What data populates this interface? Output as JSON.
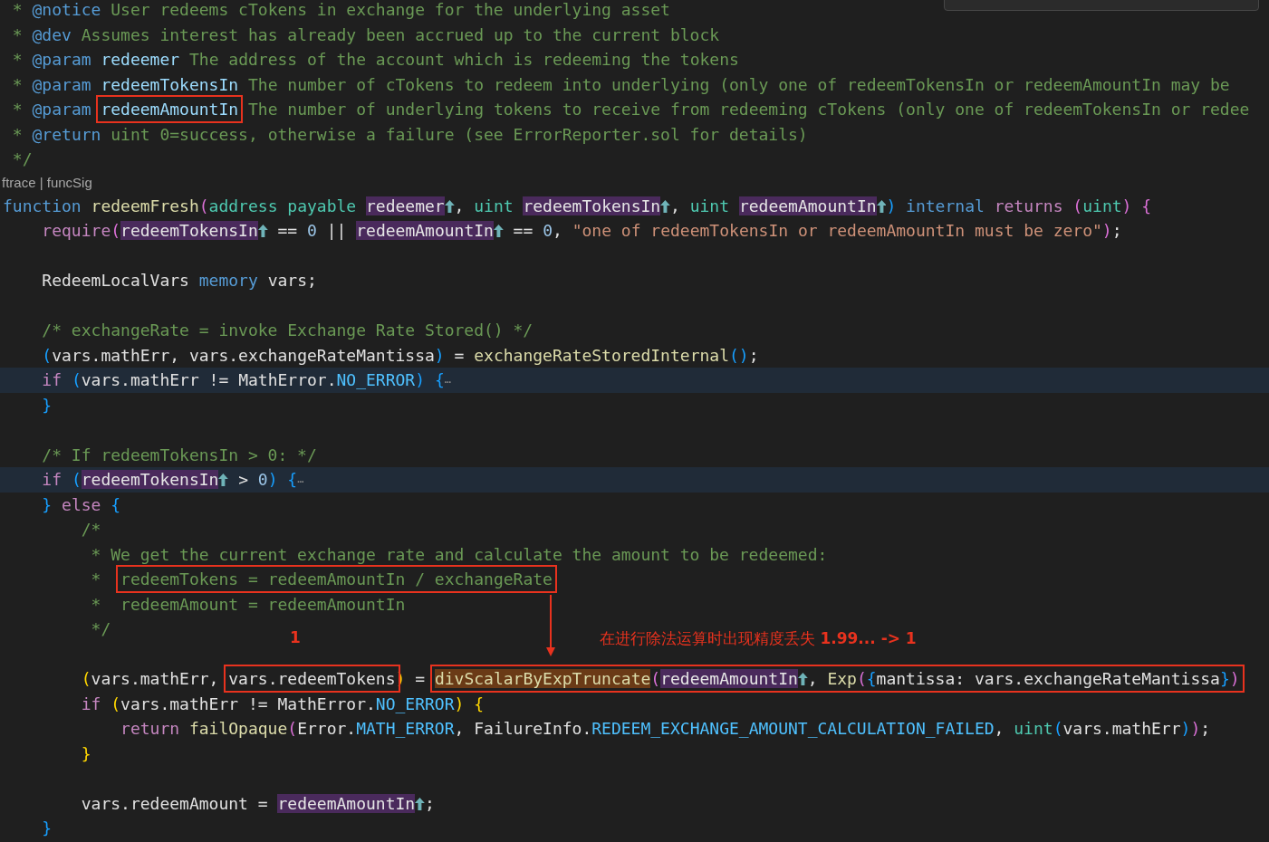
{
  "editor": {
    "lines": [
      {
        "highlighted": false,
        "tokens": [
          {
            "kind": "comment",
            "text": " * "
          },
          {
            "kind": "tag",
            "text": "@notice"
          },
          {
            "kind": "comment",
            "text": " User redeems cTokens in exchange for the underlying asset"
          }
        ]
      },
      {
        "highlighted": false,
        "tokens": [
          {
            "kind": "comment",
            "text": " * "
          },
          {
            "kind": "tag",
            "text": "@dev"
          },
          {
            "kind": "comment",
            "text": " Assumes interest has already been accrued up to the current block"
          }
        ]
      },
      {
        "highlighted": false,
        "tokens": [
          {
            "kind": "comment",
            "text": " * "
          },
          {
            "kind": "tag",
            "text": "@param"
          },
          {
            "kind": "doc",
            "text": " redeemer"
          },
          {
            "kind": "comment",
            "text": " The address of the account which is redeeming the tokens"
          }
        ]
      },
      {
        "highlighted": false,
        "tokens": [
          {
            "kind": "comment",
            "text": " * "
          },
          {
            "kind": "tag",
            "text": "@param"
          },
          {
            "kind": "doc",
            "text": " redeemTokensIn"
          },
          {
            "kind": "comment",
            "text": " The number of cTokens to redeem into underlying (only one of redeemTokensIn or redeemAmountIn may be"
          }
        ]
      },
      {
        "highlighted": false,
        "tokens": [
          {
            "kind": "comment",
            "text": " * "
          },
          {
            "kind": "tag",
            "text": "@param "
          },
          {
            "kind": "box",
            "children": [
              {
                "kind": "doc",
                "text": "redeemAmountIn"
              }
            ]
          },
          {
            "kind": "comment",
            "text": " The number of underlying tokens to receive from redeeming cTokens (only one of redeemTokensIn or redee"
          }
        ]
      },
      {
        "highlighted": false,
        "tokens": [
          {
            "kind": "comment",
            "text": " * "
          },
          {
            "kind": "tag",
            "text": "@return"
          },
          {
            "kind": "comment",
            "text": " uint 0=success, otherwise a failure (see ErrorReporter.sol for details)"
          }
        ]
      },
      {
        "highlighted": false,
        "tokens": [
          {
            "kind": "comment",
            "text": " */"
          }
        ]
      },
      {
        "highlighted": false,
        "lens": true,
        "tokens": [
          {
            "kind": "lens",
            "text": "ftrace"
          },
          {
            "kind": "sep",
            "text": " | "
          },
          {
            "kind": "lens",
            "text": "funcSig"
          }
        ]
      },
      {
        "highlighted": false,
        "tokens": [
          {
            "kind": "kw",
            "text": "function "
          },
          {
            "kind": "fn",
            "text": "redeemFresh"
          },
          {
            "kind": "br2",
            "text": "("
          },
          {
            "kind": "type",
            "text": "address payable "
          },
          {
            "kind": "ref",
            "text": "redeemer"
          },
          {
            "kind": "id",
            "text": ", "
          },
          {
            "kind": "type",
            "text": "uint "
          },
          {
            "kind": "ref",
            "text": "redeemTokensIn"
          },
          {
            "kind": "id",
            "text": ", "
          },
          {
            "kind": "type",
            "text": "uint "
          },
          {
            "kind": "ref",
            "text": "redeemAmountIn"
          },
          {
            "kind": "br3",
            "text": ") "
          },
          {
            "kind": "kw",
            "text": "internal "
          },
          {
            "kind": "ctl",
            "text": "returns "
          },
          {
            "kind": "br2",
            "text": "("
          },
          {
            "kind": "type",
            "text": "uint"
          },
          {
            "kind": "br2",
            "text": ") {"
          }
        ]
      },
      {
        "highlighted": false,
        "tokens": [
          {
            "kind": "ctl",
            "text": "    require"
          },
          {
            "kind": "br2",
            "text": "("
          },
          {
            "kind": "ref",
            "text": "redeemTokensIn"
          },
          {
            "kind": "id",
            "text": " == "
          },
          {
            "kind": "num",
            "text": "0"
          },
          {
            "kind": "id",
            "text": " || "
          },
          {
            "kind": "ref",
            "text": "redeemAmountIn"
          },
          {
            "kind": "id",
            "text": " == "
          },
          {
            "kind": "num",
            "text": "0"
          },
          {
            "kind": "id",
            "text": ", "
          },
          {
            "kind": "str",
            "text": "\"one of redeemTokensIn or redeemAmountIn must be zero\""
          },
          {
            "kind": "br2",
            "text": ")"
          },
          {
            "kind": "id",
            "text": ";"
          }
        ]
      },
      {
        "highlighted": false
      },
      {
        "highlighted": false,
        "tokens": [
          {
            "kind": "id",
            "text": "    RedeemLocalVars "
          },
          {
            "kind": "kw",
            "text": "memory"
          },
          {
            "kind": "id",
            "text": " vars;"
          }
        ]
      },
      {
        "highlighted": false
      },
      {
        "highlighted": false,
        "tokens": [
          {
            "kind": "comment",
            "text": "    /* exchangeRate = invoke Exchange Rate Stored() */"
          }
        ]
      },
      {
        "highlighted": false,
        "tokens": [
          {
            "kind": "br3",
            "text": "    ("
          },
          {
            "kind": "id",
            "text": "vars.mathErr, vars.exchangeRateMantissa"
          },
          {
            "kind": "br3",
            "text": ")"
          },
          {
            "kind": "id",
            "text": " = "
          },
          {
            "kind": "fn",
            "text": "exchangeRateStoredInternal"
          },
          {
            "kind": "br3",
            "text": "()"
          },
          {
            "kind": "id",
            "text": ";"
          }
        ]
      },
      {
        "highlighted": true,
        "tokens": [
          {
            "kind": "ctl",
            "text": "    if "
          },
          {
            "kind": "br3",
            "text": "("
          },
          {
            "kind": "id",
            "text": "vars.mathErr != MathError."
          },
          {
            "kind": "const",
            "text": "NO_ERROR"
          },
          {
            "kind": "br3",
            "text": ") {"
          },
          {
            "kind": "fold",
            "text": "⋯"
          }
        ]
      },
      {
        "highlighted": false,
        "tokens": [
          {
            "kind": "br3",
            "text": "    }"
          }
        ]
      },
      {
        "highlighted": false
      },
      {
        "highlighted": false,
        "tokens": [
          {
            "kind": "comment",
            "text": "    /* If redeemTokensIn > 0: */"
          }
        ]
      },
      {
        "highlighted": true,
        "tokens": [
          {
            "kind": "ctl",
            "text": "    if "
          },
          {
            "kind": "br3",
            "text": "("
          },
          {
            "kind": "ref",
            "text": "redeemTokensIn"
          },
          {
            "kind": "id",
            "text": " > "
          },
          {
            "kind": "num",
            "text": "0"
          },
          {
            "kind": "br3",
            "text": ") {"
          },
          {
            "kind": "fold",
            "text": "⋯"
          }
        ]
      },
      {
        "highlighted": false,
        "tokens": [
          {
            "kind": "br3",
            "text": "    }"
          },
          {
            "kind": "ctl",
            "text": " else "
          },
          {
            "kind": "br3",
            "text": "{"
          }
        ]
      },
      {
        "highlighted": false,
        "tokens": [
          {
            "kind": "comment",
            "text": "        /*"
          }
        ]
      },
      {
        "highlighted": false,
        "tokens": [
          {
            "kind": "comment",
            "text": "         * We get the current exchange rate and calculate the amount to be redeemed:"
          }
        ]
      },
      {
        "highlighted": false,
        "tokens": [
          {
            "kind": "comment",
            "text": "         *  "
          },
          {
            "kind": "box",
            "children": [
              {
                "kind": "comment",
                "text": "redeemTokens = redeemAmountIn / exchangeRate"
              }
            ]
          }
        ]
      },
      {
        "highlighted": false,
        "tokens": [
          {
            "kind": "comment",
            "text": "         *  redeemAmount = redeemAmountIn"
          }
        ]
      },
      {
        "highlighted": false,
        "tokens": [
          {
            "kind": "comment",
            "text": "         */"
          }
        ]
      },
      {
        "highlighted": false
      },
      {
        "highlighted": false,
        "tokens": [
          {
            "kind": "br1",
            "text": "        ("
          },
          {
            "kind": "id",
            "text": "vars.mathErr, "
          },
          {
            "kind": "box",
            "children": [
              {
                "kind": "id",
                "text": "vars.redeemTokens"
              }
            ]
          },
          {
            "kind": "br1",
            "text": ")"
          },
          {
            "kind": "id",
            "text": " = "
          },
          {
            "kind": "box",
            "children": [
              {
                "kind": "fnhl",
                "text": "divScalarByExpTruncate"
              },
              {
                "kind": "br2",
                "text": "("
              },
              {
                "kind": "ref",
                "text": "redeemAmountIn"
              },
              {
                "kind": "id",
                "text": ", "
              },
              {
                "kind": "fn",
                "text": "Exp"
              },
              {
                "kind": "br2",
                "text": "("
              },
              {
                "kind": "br3",
                "text": "{"
              },
              {
                "kind": "id",
                "text": "mantissa: vars.exchangeRateMantissa"
              },
              {
                "kind": "br3",
                "text": "}"
              },
              {
                "kind": "br2",
                "text": ")"
              }
            ]
          }
        ]
      },
      {
        "highlighted": false,
        "tokens": [
          {
            "kind": "ctl",
            "text": "        if "
          },
          {
            "kind": "br1",
            "text": "("
          },
          {
            "kind": "id",
            "text": "vars.mathErr != MathError."
          },
          {
            "kind": "const",
            "text": "NO_ERROR"
          },
          {
            "kind": "br1",
            "text": ") {"
          }
        ]
      },
      {
        "highlighted": false,
        "tokens": [
          {
            "kind": "ctl",
            "text": "            return "
          },
          {
            "kind": "fn",
            "text": "failOpaque"
          },
          {
            "kind": "br2",
            "text": "("
          },
          {
            "kind": "id",
            "text": "Error."
          },
          {
            "kind": "const",
            "text": "MATH_ERROR"
          },
          {
            "kind": "id",
            "text": ", FailureInfo."
          },
          {
            "kind": "const",
            "text": "REDEEM_EXCHANGE_AMOUNT_CALCULATION_FAILED"
          },
          {
            "kind": "id",
            "text": ", "
          },
          {
            "kind": "type",
            "text": "uint"
          },
          {
            "kind": "br3",
            "text": "("
          },
          {
            "kind": "id",
            "text": "vars.mathErr"
          },
          {
            "kind": "br3",
            "text": ")"
          },
          {
            "kind": "br2",
            "text": ")"
          },
          {
            "kind": "id",
            "text": ";"
          }
        ]
      },
      {
        "highlighted": false,
        "tokens": [
          {
            "kind": "br1",
            "text": "        }"
          }
        ]
      },
      {
        "highlighted": false
      },
      {
        "highlighted": false,
        "tokens": [
          {
            "kind": "id",
            "text": "        vars.redeemAmount = "
          },
          {
            "kind": "ref",
            "text": "redeemAmountIn"
          },
          {
            "kind": "id",
            "text": ";"
          }
        ]
      },
      {
        "highlighted": false,
        "tokens": [
          {
            "kind": "br3",
            "text": "    }"
          }
        ]
      }
    ]
  },
  "annotations": [
    {
      "kind": "label",
      "text": "1"
    },
    {
      "kind": "note",
      "text": "在进行除法运算时出现精度丢失 **1.99... -> 1**"
    }
  ]
}
